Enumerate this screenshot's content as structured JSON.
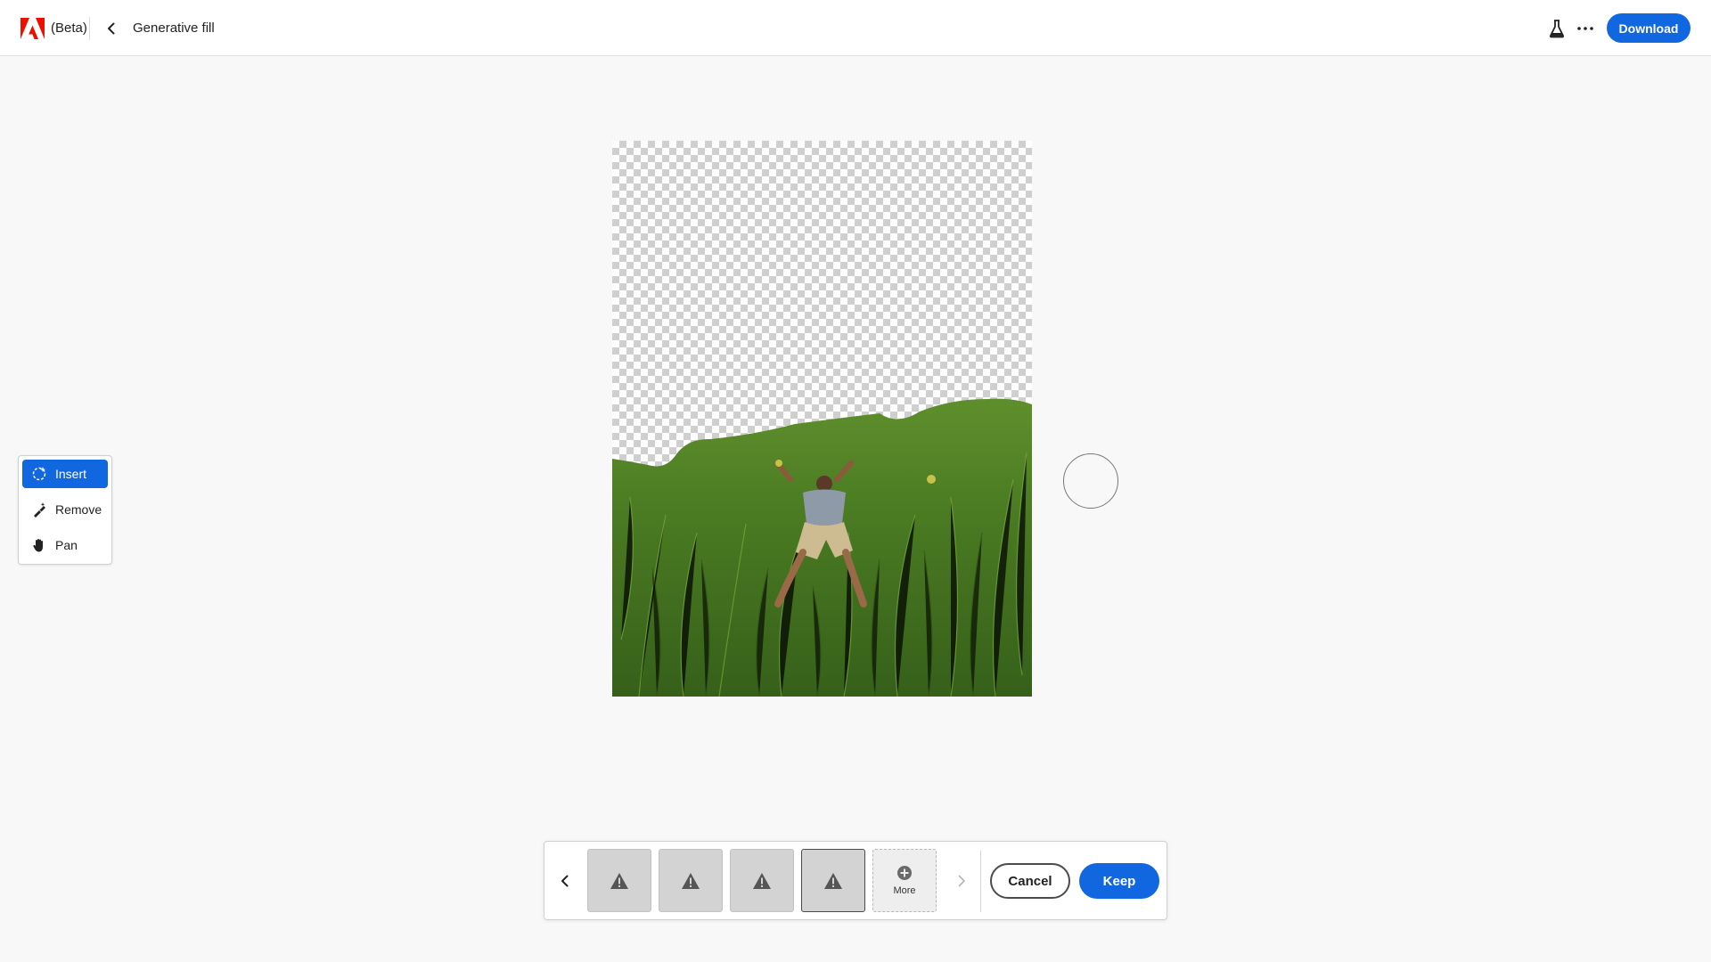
{
  "header": {
    "badge": "(Beta)",
    "title": "Generative fill",
    "download_label": "Download"
  },
  "toolbar": {
    "tools": [
      {
        "label": "Insert",
        "icon": "insert-sparkle-icon",
        "active": true
      },
      {
        "label": "Remove",
        "icon": "remove-brush-icon",
        "active": false
      },
      {
        "label": "Pan",
        "icon": "hand-icon",
        "active": false
      }
    ]
  },
  "results": {
    "variations": [
      {
        "state": "warning",
        "selected": false
      },
      {
        "state": "warning",
        "selected": false
      },
      {
        "state": "warning",
        "selected": false
      },
      {
        "state": "warning",
        "selected": true
      }
    ],
    "more_label": "More",
    "cancel_label": "Cancel",
    "keep_label": "Keep"
  },
  "colors": {
    "accent": "#1167e0",
    "adobe_red": "#eb1000",
    "grass": "#4f7f26"
  }
}
